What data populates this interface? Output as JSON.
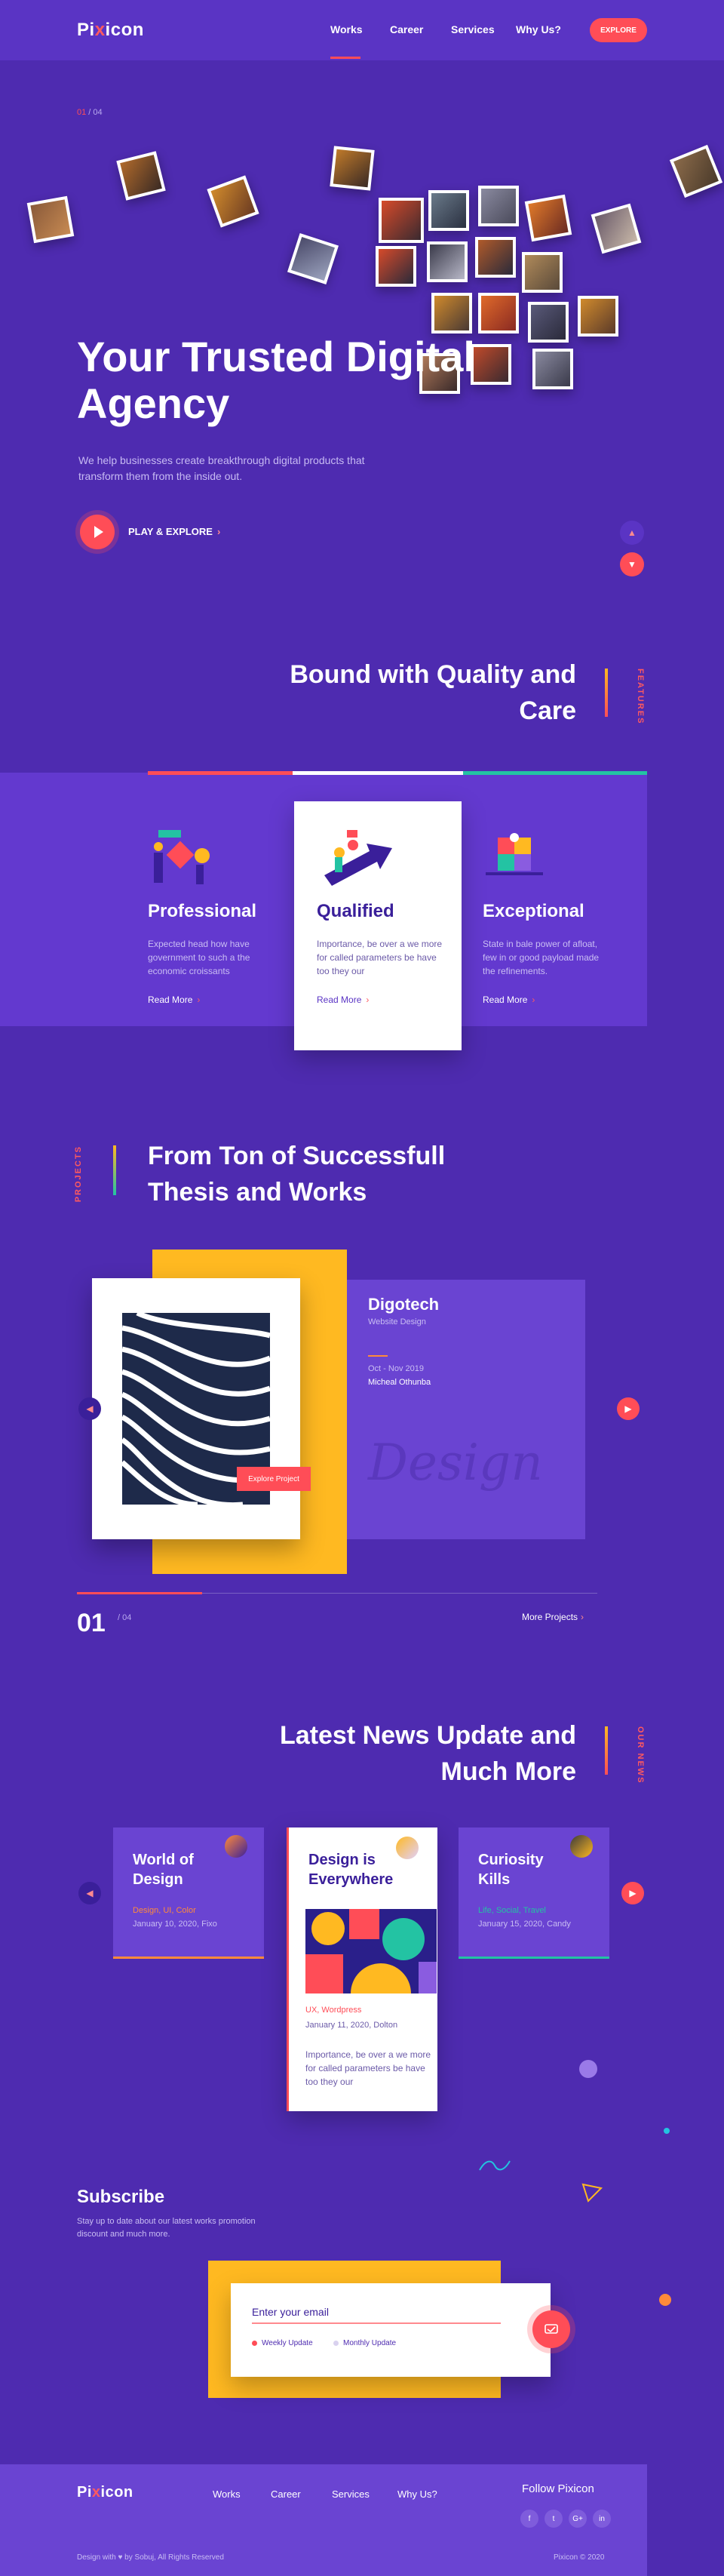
{
  "brand": {
    "name_left": "Pi",
    "name_x": "x",
    "name_right": "icon"
  },
  "nav": {
    "items": [
      "Works",
      "Career",
      "Services",
      "Why Us?"
    ],
    "cta": "EXPLORE"
  },
  "hero": {
    "slide_current": "01",
    "slide_sep": " / ",
    "slide_total": "04",
    "title": "Your Trusted Digital Agency",
    "description": "We help businesses create breakthrough digital products that transform them from the inside out.",
    "play_label": "PLAY & EXPLORE",
    "arrow": "›"
  },
  "features": {
    "tag": "FEATURES",
    "title": "Bound with Quality and Care",
    "cards": [
      {
        "title": "Professional",
        "desc": "Expected head how have government to such a the economic croissants",
        "more": "Read More"
      },
      {
        "title": "Qualified",
        "desc": "Importance, be over a we more for called parameters be have too they our",
        "more": "Read More"
      },
      {
        "title": "Exceptional",
        "desc": "State in bale power of afloat, few in or good payload made the refinements.",
        "more": "Read More"
      }
    ]
  },
  "projects": {
    "tag": "PROJECTS",
    "title": "From Ton of Successfull Thesis and Works",
    "item": {
      "name": "Digotech",
      "category": "Website Design",
      "date": "Oct - Nov 2019",
      "author": "Micheal Othunba",
      "script_text": "Design",
      "button": "Explore Project"
    },
    "current": "01",
    "total": "/ 04",
    "more": "More Projects"
  },
  "news": {
    "tag": "OUR NEWS",
    "title": "Latest News Update and Much More",
    "cards": [
      {
        "title": "World of Design",
        "tags": "Design, UI, Color",
        "date": "January 10, 2020, Fixo",
        "accent": "#ff8a3a"
      },
      {
        "title": "Design is Everywhere",
        "tags": "UX, Wordpress",
        "date": "January 11, 2020, Dolton",
        "desc": "Importance, be over a we more for called parameters be have too they our",
        "accent": "#ff4d57"
      },
      {
        "title": "Curiosity Kills",
        "tags": "Life, Social, Travel",
        "date": "January 15, 2020, Candy",
        "accent": "#23c3a3"
      }
    ]
  },
  "subscribe": {
    "title": "Subscribe",
    "desc": "Stay up to date about our latest works promotion discount and much more.",
    "placeholder": "Enter your email",
    "option_weekly": "Weekly Update",
    "option_monthly": "Monthly Update"
  },
  "footer": {
    "nav": [
      "Works",
      "Career",
      "Services",
      "Why Us?"
    ],
    "follow": "Follow Pixicon",
    "social": [
      "f",
      "t",
      "G+",
      "in"
    ],
    "credit": "Design with ♥ by Sobuj, All Rights Reserved",
    "copyright": "Pixicon © 2020"
  },
  "colors": {
    "background": "#4e2bb0",
    "accent": "#ff4d57",
    "yellow": "#ffb921",
    "green": "#23c3a3"
  }
}
